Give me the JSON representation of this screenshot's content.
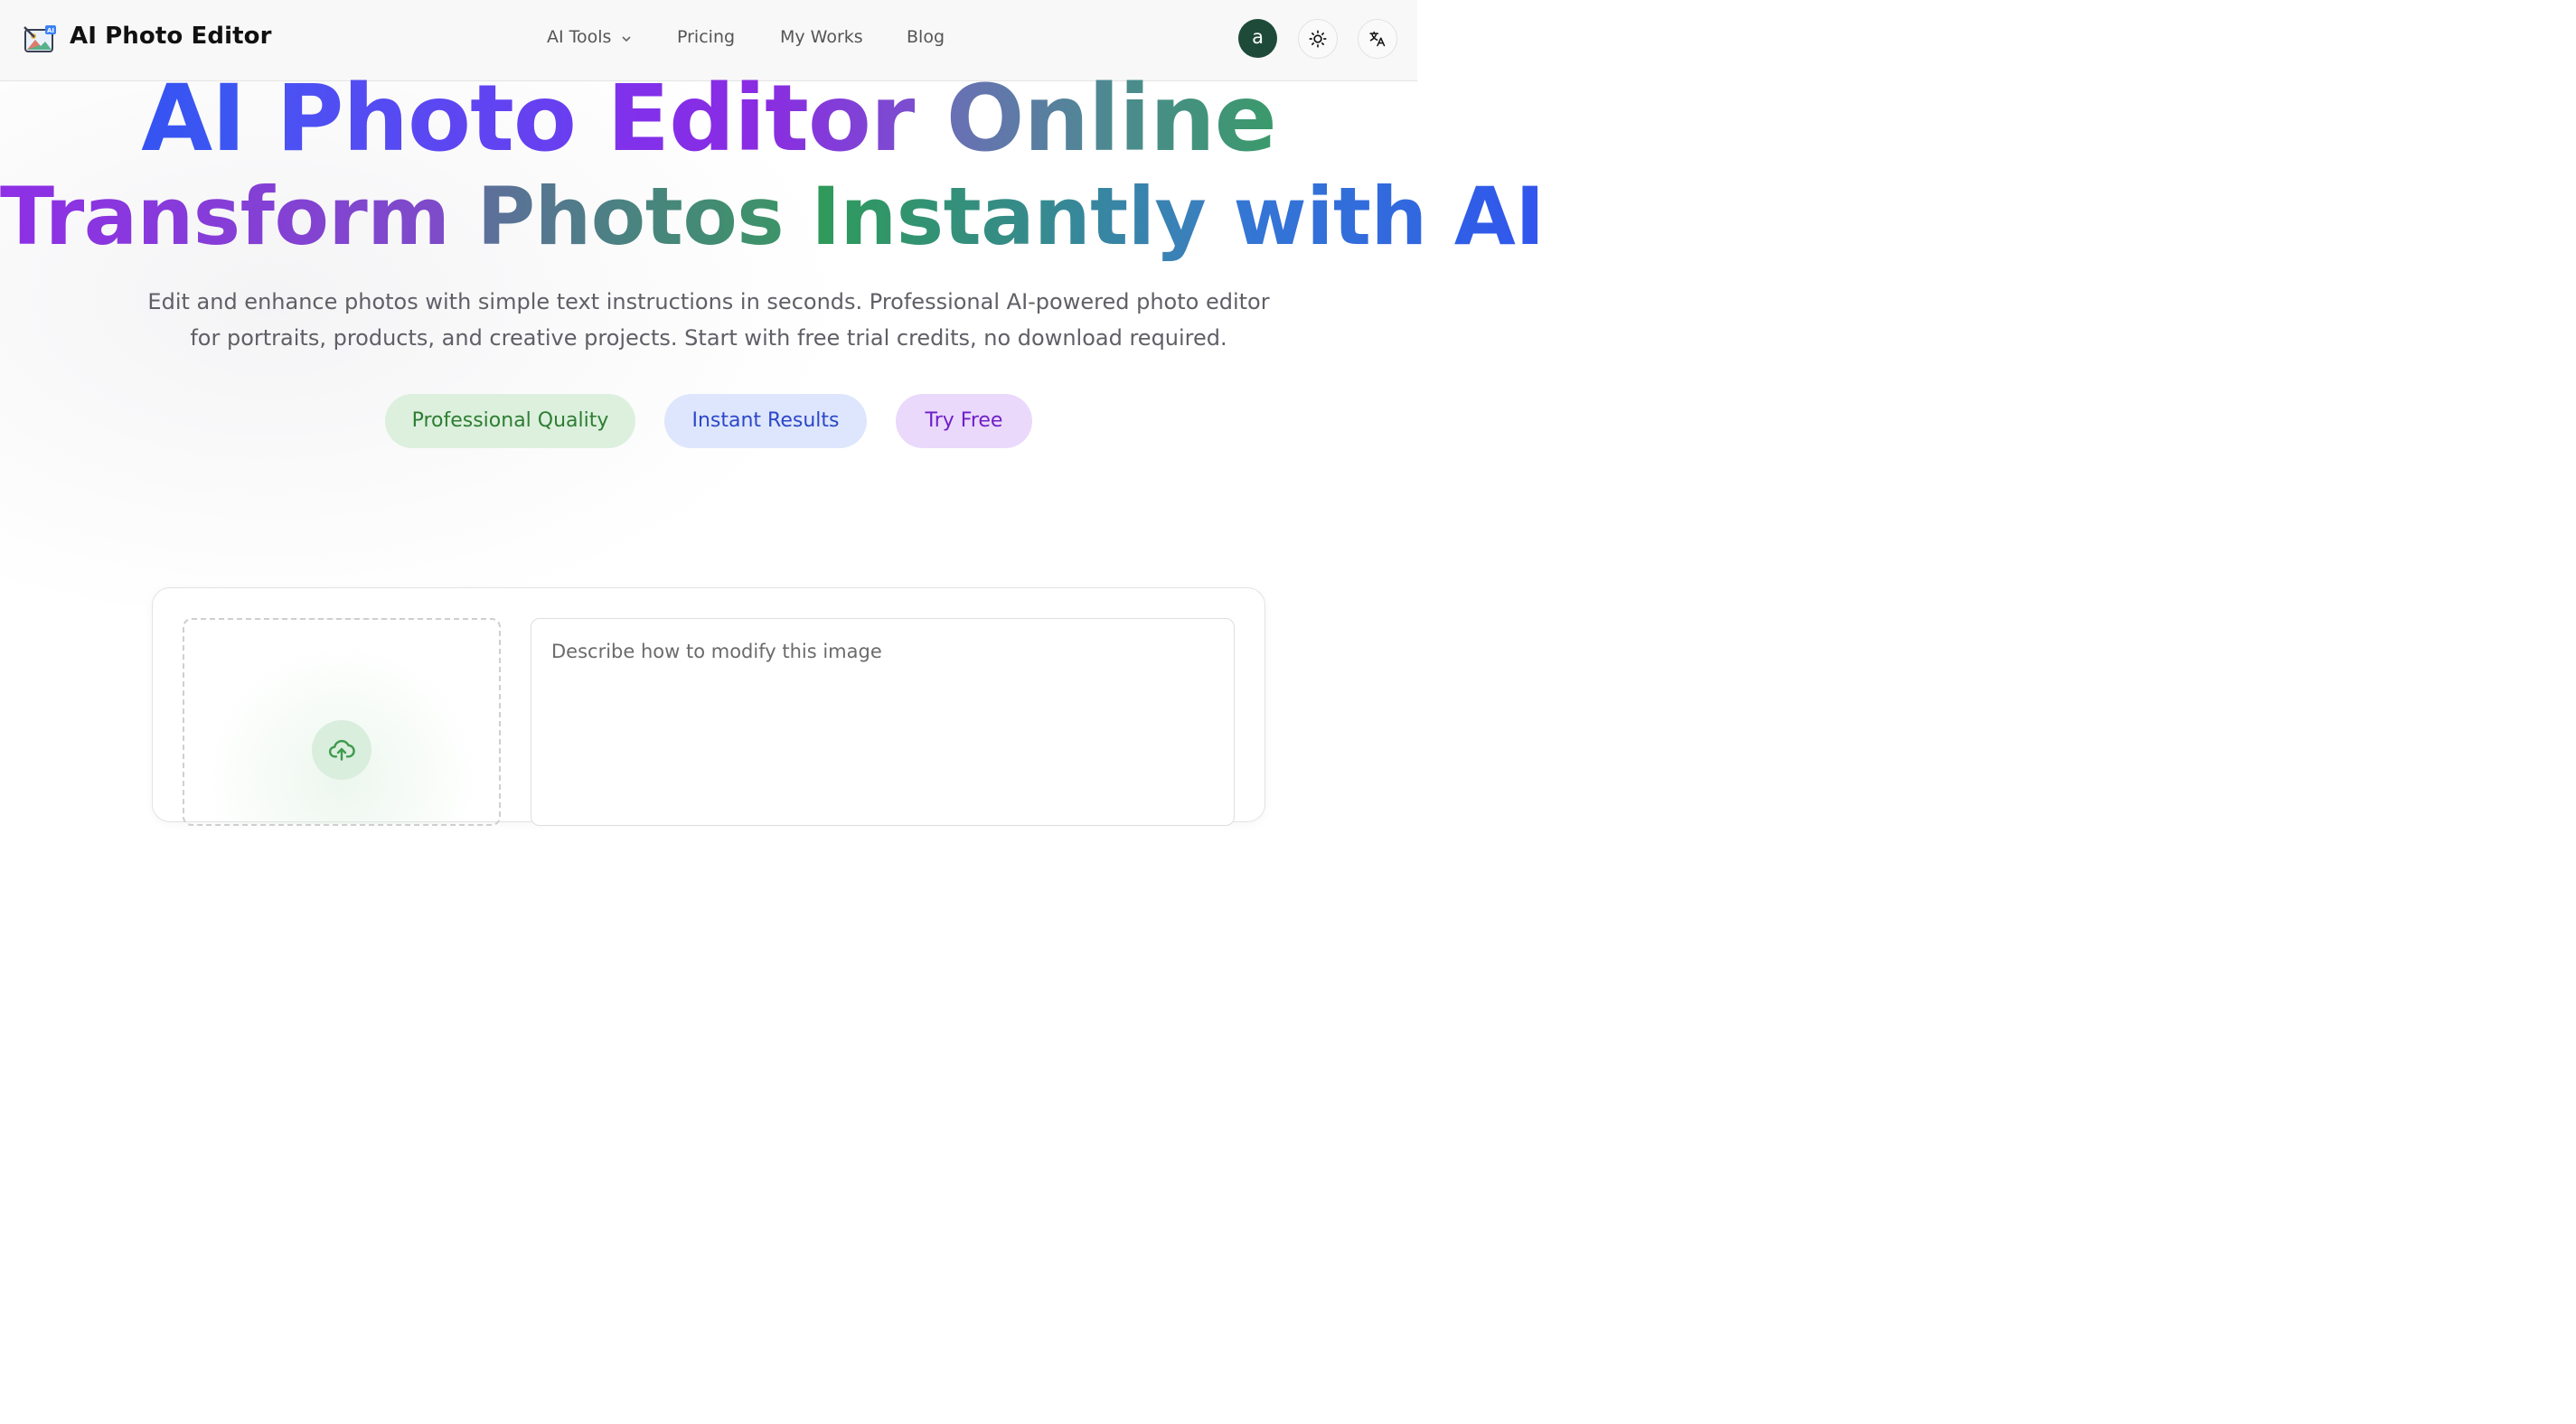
{
  "header": {
    "brand": "AI Photo Editor",
    "nav": [
      "AI Tools",
      "Pricing",
      "My Works",
      "Blog"
    ],
    "avatar_initial": "a"
  },
  "hero": {
    "title_words": [
      "AI",
      "Photo",
      "Editor",
      "Online"
    ],
    "subtitle_words": [
      "Transform",
      "Photos",
      "Instantly",
      "with",
      "AI"
    ],
    "description": "Edit and enhance photos with simple text instructions in seconds. Professional AI-powered photo editor for portraits, products, and creative projects. Start with free trial credits, no download required.",
    "badges": [
      "Professional Quality",
      "Instant Results",
      "Try Free"
    ]
  },
  "editor": {
    "prompt_placeholder": "Describe how to modify this image"
  },
  "colors": {
    "gradient_blue": "#3a57f0",
    "gradient_purple": "#8a2be2",
    "gradient_green": "#3a9a5c",
    "badge_green_bg": "#dcf0dd",
    "badge_green_text": "#2e7d32",
    "badge_blue_bg": "#dde6fc",
    "badge_blue_text": "#2c47c9",
    "badge_purple_bg": "#ead9fb",
    "badge_purple_text": "#6f1fc7",
    "avatar_bg": "#1e4a3a"
  },
  "icons": [
    "app-logo-icon",
    "chevron-down-icon",
    "sun-icon",
    "translate-icon",
    "upload-cloud-icon"
  ]
}
